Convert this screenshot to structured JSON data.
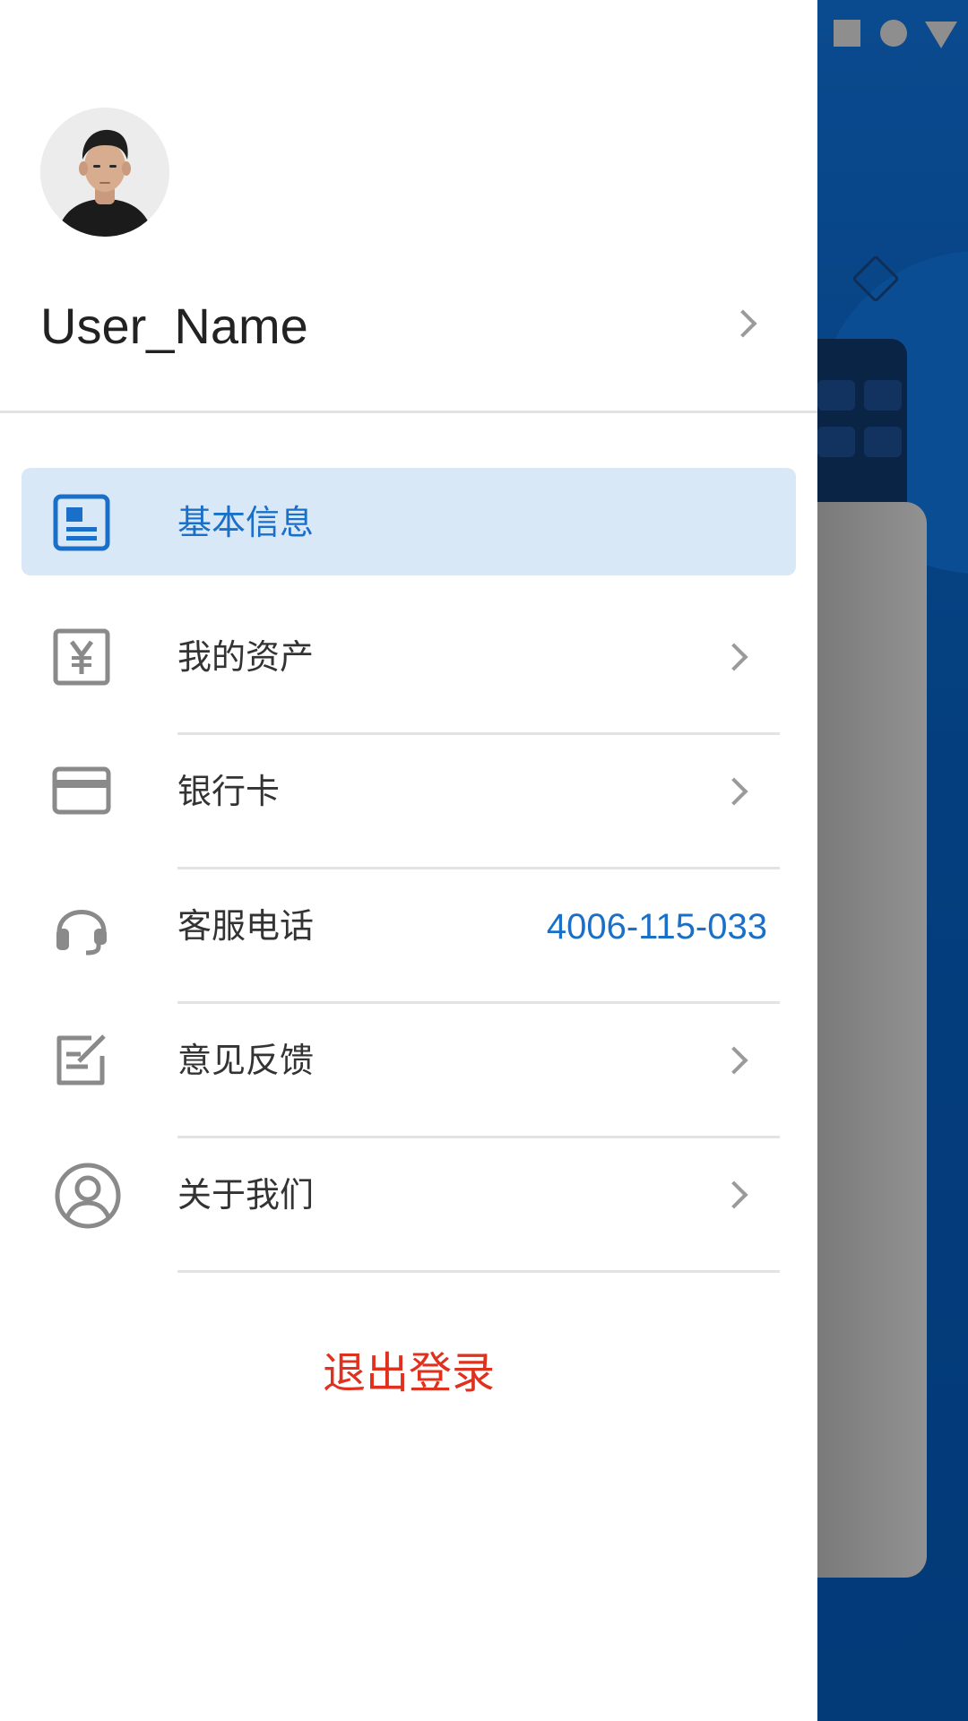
{
  "status_bar": {
    "icons": [
      "square-icon",
      "circle-icon",
      "triangle-icon"
    ]
  },
  "profile": {
    "avatar_icon": "avatar-photo",
    "user_name": "User_Name"
  },
  "menu": [
    {
      "label": "基本信息",
      "icon": "id-card-icon",
      "active": true,
      "has_chevron": false,
      "value": ""
    },
    {
      "label": "我的资产",
      "icon": "yen-box-icon",
      "active": false,
      "has_chevron": true,
      "value": ""
    },
    {
      "label": "银行卡",
      "icon": "bank-card-icon",
      "active": false,
      "has_chevron": true,
      "value": ""
    },
    {
      "label": "客服电话",
      "icon": "headset-icon",
      "active": false,
      "has_chevron": false,
      "value": "4006-115-033"
    },
    {
      "label": "意见反馈",
      "icon": "feedback-icon",
      "active": false,
      "has_chevron": true,
      "value": ""
    },
    {
      "label": "关于我们",
      "icon": "user-circle-icon",
      "active": false,
      "has_chevron": true,
      "value": ""
    }
  ],
  "logout": {
    "label": "退出登录"
  },
  "colors": {
    "accent_blue": "#1a6fc9",
    "active_bg": "#d9e8f7",
    "logout_red": "#e0301e",
    "icon_gray": "#8a8a8a",
    "backdrop_blue": "#043e7e"
  }
}
